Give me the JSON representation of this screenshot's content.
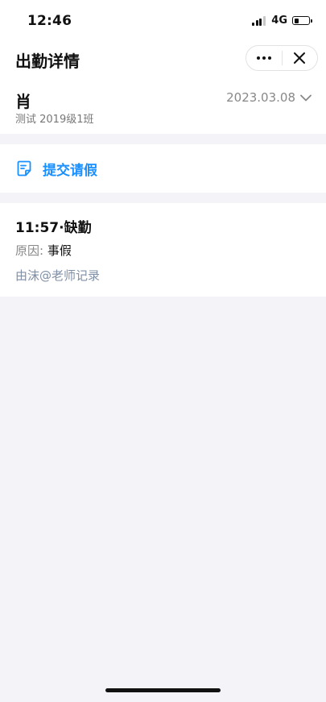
{
  "status_bar": {
    "time": "12:46",
    "network": "4G",
    "signal_bars": 3,
    "signal_bars_total": 4,
    "battery_level": 0.35
  },
  "nav": {
    "title": "出勤详情"
  },
  "student": {
    "name": "肖",
    "class": "测试 2019级1班",
    "date": "2023.03.08"
  },
  "leave": {
    "label": "提交请假",
    "accent_color": "#1890ff"
  },
  "record": {
    "status": "11:57·缺勤",
    "reason_label": "原因:",
    "reason_value": "事假",
    "recorder": "由沫@老师记录"
  }
}
